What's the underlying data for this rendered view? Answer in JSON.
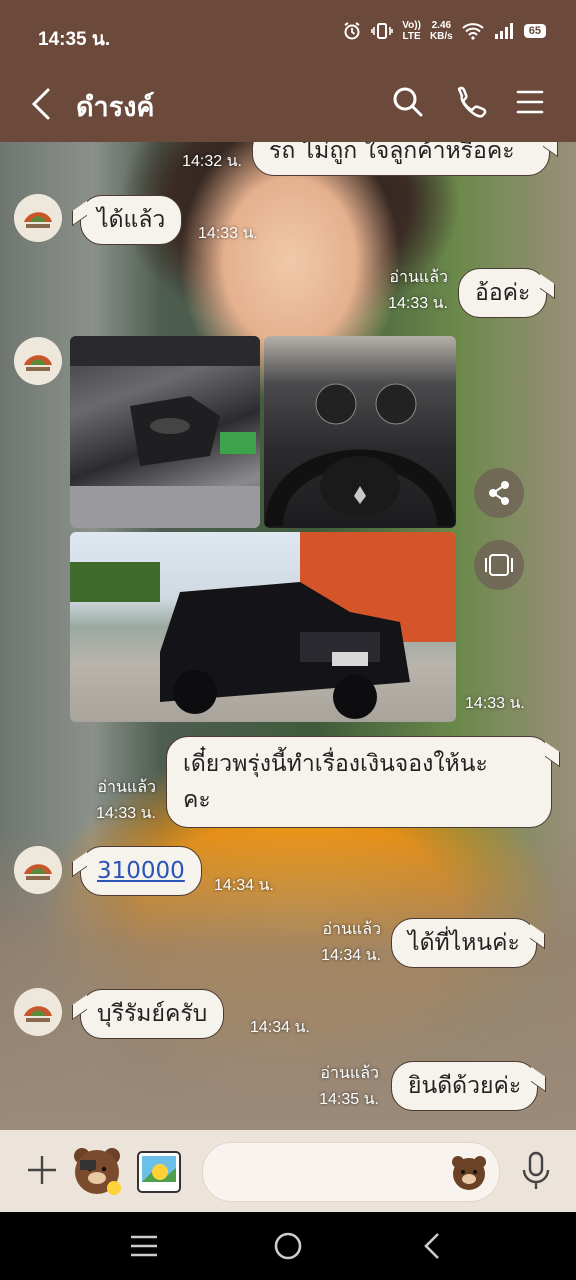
{
  "status_bar": {
    "time": "14:35 น.",
    "volte_top": "Vo))",
    "volte_bottom": "LTE",
    "speed_value": "2.46",
    "speed_unit": "KB/s",
    "battery": "65"
  },
  "header": {
    "title": "ดำรงค์",
    "icons": [
      "back-icon",
      "search-icon",
      "phone-icon",
      "menu-icon"
    ]
  },
  "messages": [
    {
      "text": "รถ ไม่ถูก ใจลูกค้าหรือคะ",
      "time": "14:32 น.",
      "direction": "out"
    },
    {
      "text": "ได้แล้ว",
      "time": "14:33 น.",
      "direction": "in"
    },
    {
      "text": "อ้อค่ะ",
      "read": "อ่านแล้ว",
      "time": "14:33 น.",
      "direction": "out"
    },
    {
      "type": "photos",
      "time": "14:33 น.",
      "direction": "in",
      "photos": [
        "engine-photo",
        "dashboard-photo",
        "pickup-truck-photo"
      ]
    },
    {
      "text": "เดี๋ยวพรุ่งนี้ทำเรื่องเงินจองให้นะคะ",
      "line1": "เดี๋ยวพรุ่งนี้ทำเรื่องเงินจองให้นะ",
      "line2": "คะ",
      "read": "อ่านแล้ว",
      "time": "14:33 น.",
      "direction": "out"
    },
    {
      "text": "310000",
      "time": "14:34 น.",
      "direction": "in"
    },
    {
      "text": "ได้ที่ไหนค่ะ",
      "read": "อ่านแล้ว",
      "time": "14:34 น.",
      "direction": "out"
    },
    {
      "text": "บุรีรัมย์ครับ",
      "time": "14:34 น.",
      "direction": "in"
    },
    {
      "text": "ยินดีด้วยค่ะ",
      "read": "อ่านแล้ว",
      "time": "14:35 น.",
      "direction": "out"
    }
  ],
  "input_bar": {
    "icons": [
      "plus-icon",
      "sticker-brown-icon",
      "gallery-icon",
      "emoji-icon",
      "mic-icon"
    ]
  },
  "colors": {
    "header_bg": "#6b4a3b",
    "bubble_bg": "#f6f2ec",
    "link": "#2a53b8"
  }
}
